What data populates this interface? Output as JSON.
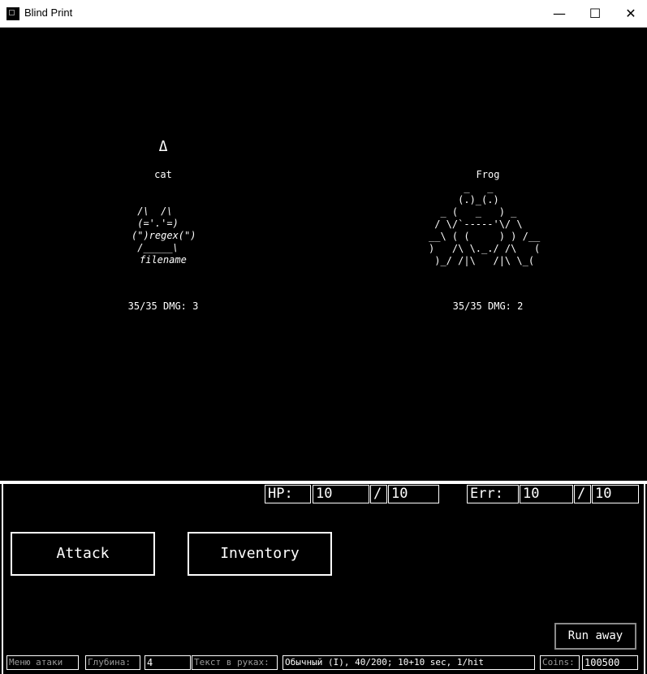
{
  "window": {
    "title": "Blind Print",
    "minimize_glyph": "—",
    "maximize_glyph": "☐",
    "close_glyph": "✕",
    "icon": "app-icon"
  },
  "battle": {
    "turn_indicator": "Δ",
    "player": {
      "name": "cat",
      "art": [
        " /\\  /\\",
        " (='.'=)",
        "(\")regex(\")",
        " /_____\\"
      ],
      "art_caption": "filename",
      "hp_dmg": "35/35 DMG: 3"
    },
    "enemy": {
      "name": "Frog",
      "art": [
        "      _   _",
        "     (.)_(.)",
        "  _ (   _   ) _",
        " / \\/`-----'\\/ \\",
        "__\\ ( (     ) ) /__",
        ")   /\\ \\._./ /\\   (",
        " )_/ /|\\   /|\\ \\_("
      ],
      "hp_dmg": "35/35 DMG: 2"
    }
  },
  "stats": {
    "hp_label": "HP:",
    "hp_current": "10",
    "hp_sep": "/",
    "hp_max": "10",
    "err_label": "Err:",
    "err_current": "10",
    "err_sep": "/",
    "err_max": "10"
  },
  "actions": {
    "attack": "Attack",
    "inventory": "Inventory",
    "run_away": "Run away"
  },
  "status_bar": {
    "menu_label": "Меню атаки",
    "depth_label": "Глубина:",
    "depth_value": "4",
    "hand_label": "Текст в руках:",
    "hand_value": "Обычный (I), 40/200; 10+10 sec, 1/hit",
    "coins_label": "Coins:",
    "coins_value": "100500"
  }
}
